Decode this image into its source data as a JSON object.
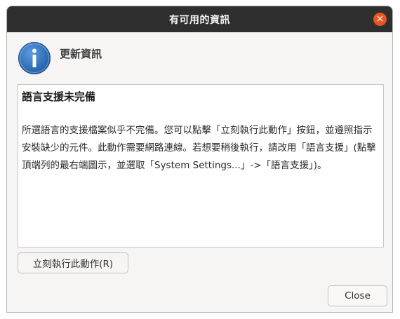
{
  "window": {
    "title": "有可用的資訊",
    "close_glyph": "×"
  },
  "header": {
    "icon": "info-icon",
    "title": "更新資訊"
  },
  "content": {
    "heading": "語言支援未完備",
    "body": "所選語言的支援檔案似乎不完備。您可以點擊「立刻執行此動作」按鈕，並遵照指示安裝缺少的元件。此動作需要網路連線。若想要稍後執行，請改用「語言支援」(點擊頂端列的最右端圖示，並選取「System Settings...」->「語言支援」)。"
  },
  "buttons": {
    "action_label": "立刻執行此動作(R)",
    "close_label": "Close"
  },
  "colors": {
    "titlebar": "#2f2f2f",
    "close_accent": "#e95420",
    "info_blue": "#2f6fb7"
  }
}
